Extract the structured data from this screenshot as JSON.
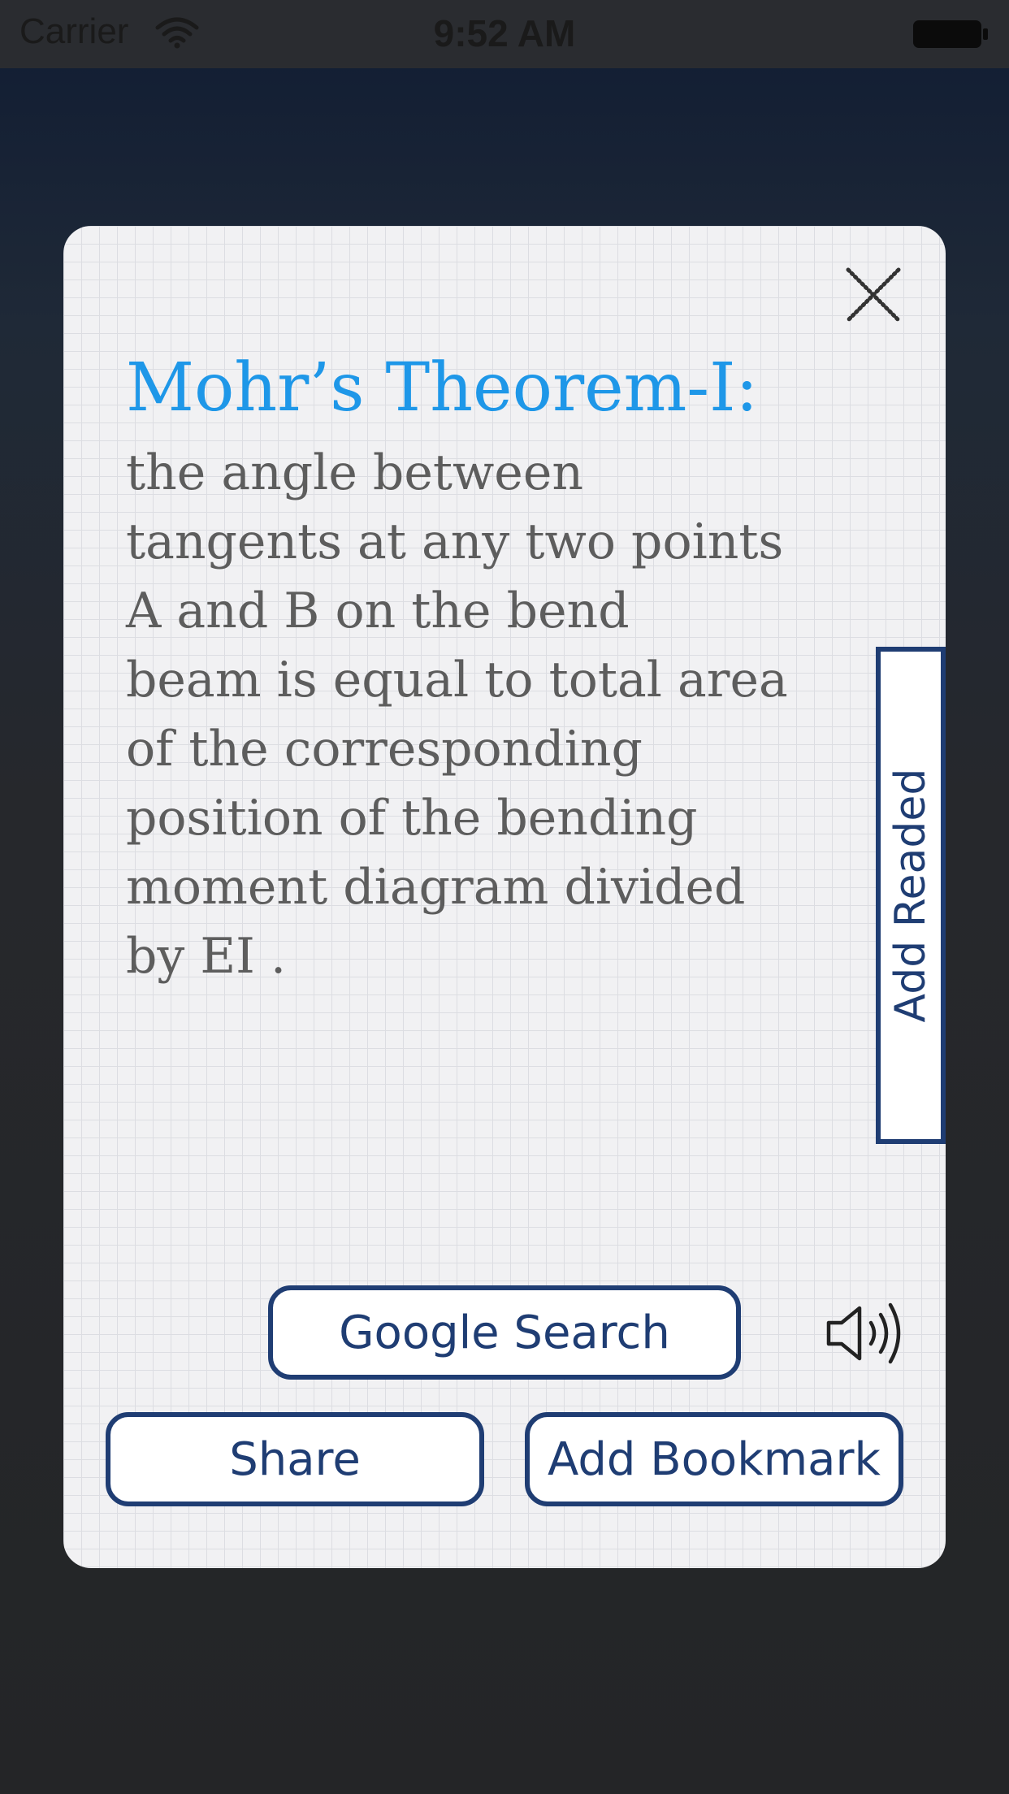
{
  "status_bar": {
    "carrier": "Carrier",
    "time": "9:52 AM",
    "wifi_icon": "wifi-icon",
    "battery_icon": "battery-icon"
  },
  "card": {
    "title": "Mohr’s Theorem-I:",
    "body": "the angle  between\ntangents at any two points\nA and B on the bend\nbeam is equal to total area\nof the corresponding\nposition of the bending\nmoment diagram divided\nby EI .",
    "close_icon": "close-icon",
    "speaker_icon": "speaker-icon"
  },
  "buttons": {
    "add_readed": "Add Readed",
    "google_search": "Google Search",
    "share": "Share",
    "add_bookmark": "Add Bookmark"
  },
  "colors": {
    "title": "#1e97e8",
    "button_border": "#1f3d73",
    "body_text": "#5d5d5d",
    "card_background": "#f1f1f3"
  }
}
